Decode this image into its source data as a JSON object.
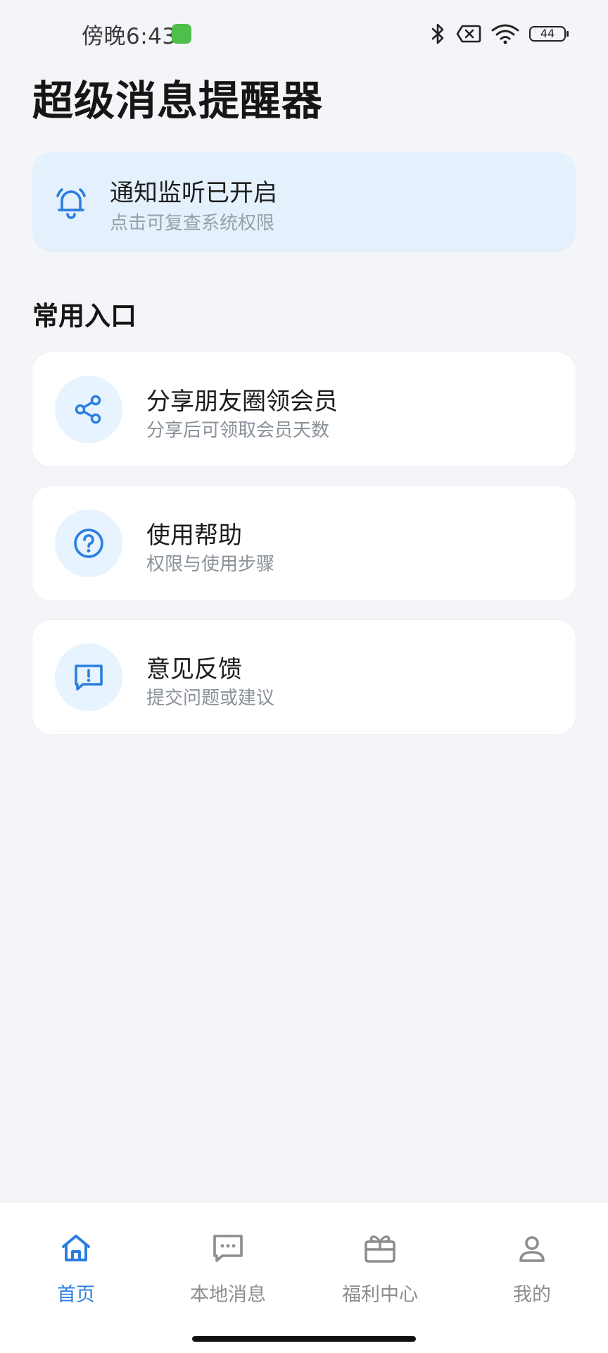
{
  "status_bar": {
    "time": "傍晚6:43",
    "battery": "44"
  },
  "app": {
    "title": "超级消息提醒器"
  },
  "notification": {
    "title": "通知监听已开启",
    "subtitle": "点击可复查系统权限"
  },
  "common_entries": {
    "heading": "常用入口",
    "items": [
      {
        "title": "分享朋友圈领会员",
        "subtitle": "分享后可领取会员天数",
        "icon": "share-icon"
      },
      {
        "title": "使用帮助",
        "subtitle": "权限与使用步骤",
        "icon": "help-icon"
      },
      {
        "title": "意见反馈",
        "subtitle": "提交问题或建议",
        "icon": "feedback-icon"
      }
    ]
  },
  "bottom_nav": {
    "items": [
      {
        "label": "首页",
        "icon": "home-icon",
        "active": true
      },
      {
        "label": "本地消息",
        "icon": "message-icon",
        "active": false
      },
      {
        "label": "福利中心",
        "icon": "gift-icon",
        "active": false
      },
      {
        "label": "我的",
        "icon": "profile-icon",
        "active": false
      }
    ]
  },
  "colors": {
    "accent": "#2b7ee0",
    "background": "#f3f5f8",
    "notify_card_bg": "#e4f1fd",
    "icon_circle_bg": "#e7f3fe",
    "inactive": "#8d8d8d"
  }
}
